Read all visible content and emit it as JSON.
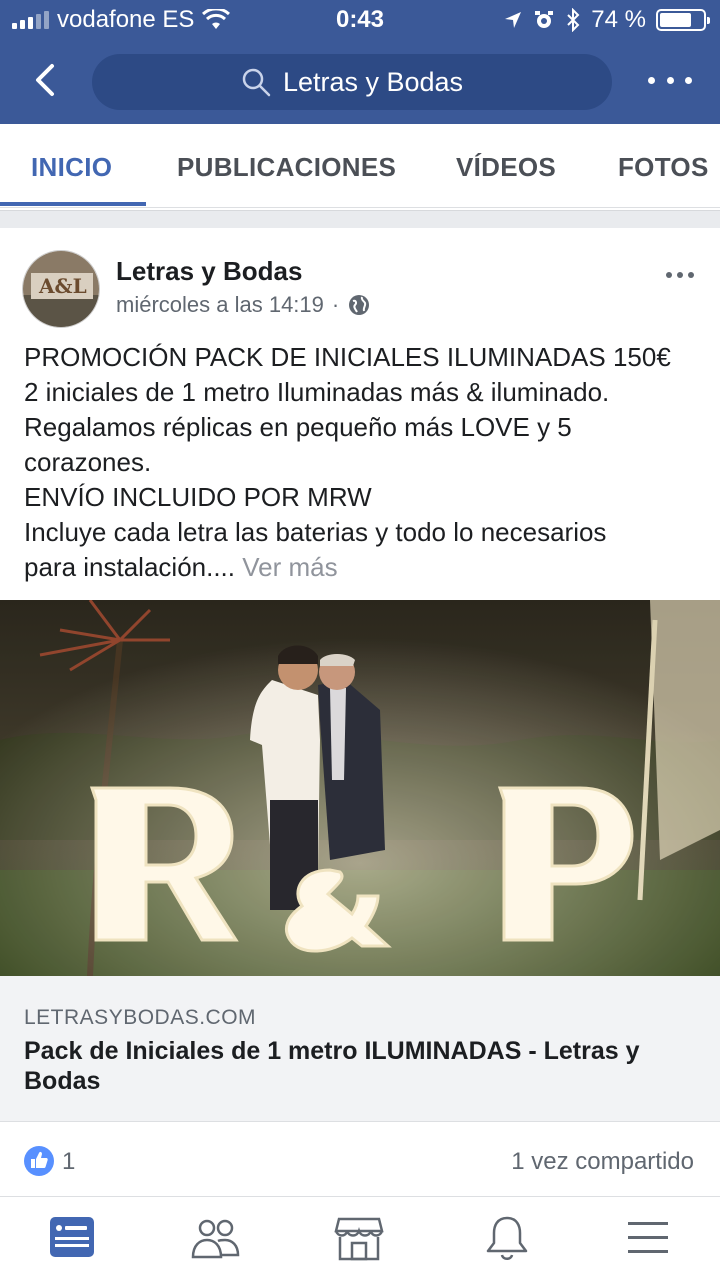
{
  "status_bar": {
    "carrier": "vodafone ES",
    "time": "0:43",
    "battery": "74 %",
    "battery_level": 0.74
  },
  "header": {
    "search_text": "Letras y Bodas"
  },
  "tabs": [
    {
      "label": "INICIO",
      "active": true
    },
    {
      "label": "PUBLICACIONES",
      "active": false
    },
    {
      "label": "VÍDEOS",
      "active": false
    },
    {
      "label": "FOTOS",
      "active": false
    }
  ],
  "post": {
    "author": "Letras y Bodas",
    "timestamp": "miércoles a las 14:19",
    "separator": "·",
    "lines": [
      "PROMOCIÓN PACK DE INICIALES ILUMINADAS 150€",
      "2 iniciales de 1 metro Iluminadas más & iluminado.",
      "Regalamos réplicas en pequeño más LOVE y 5",
      "corazones.",
      "ENVÍO INCLUIDO POR MRW",
      "Incluye cada letra las baterias y todo lo necesarios"
    ],
    "last_line": "para instalación....",
    "see_more": "Ver más",
    "link": {
      "domain": "LETRASYBODAS.COM",
      "title": "Pack de Iniciales de 1 metro ILUMINADAS - Letras y Bodas"
    },
    "like_count": "1",
    "shares": "1 vez compartido"
  },
  "colors": {
    "header_bg": "#3b5998",
    "accent": "#4267b2",
    "like_blue": "#5890ff"
  },
  "icons": {
    "back": "back-arrow-icon",
    "search": "search-icon",
    "more": "more-icon",
    "globe": "globe-icon",
    "like": "like-thumb-icon",
    "nav": [
      "news-feed-icon",
      "friends-icon",
      "marketplace-icon",
      "notifications-icon",
      "menu-icon"
    ]
  }
}
